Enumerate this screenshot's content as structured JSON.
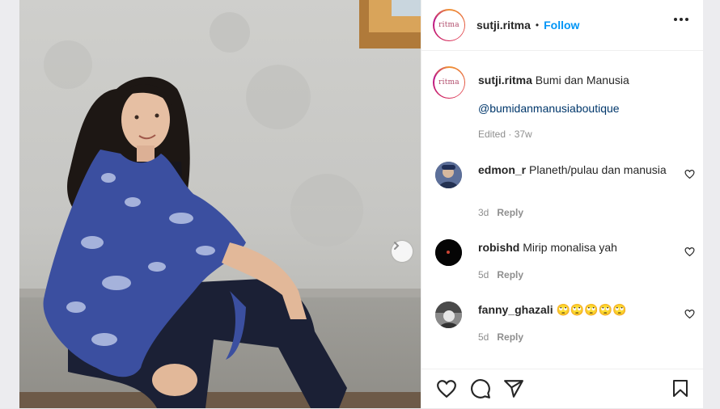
{
  "post": {
    "username": "sutji.ritma",
    "follow_label": "Follow",
    "separator": "•",
    "avatar_text": "ritma"
  },
  "caption": {
    "username": "sutji.ritma",
    "text": "Bumi dan Manusia",
    "mention": "@bumidanmanusiaboutique",
    "meta": "Edited · 37w"
  },
  "comments": [
    {
      "user": "edmon_r",
      "text": "Planeth/pulau dan manusia",
      "time": "3d",
      "reply": "Reply"
    },
    {
      "user": "robishd",
      "text": "Mirip monalisa yah",
      "time": "5d",
      "reply": "Reply"
    },
    {
      "user": "fanny_ghazali",
      "text": "🙄🙄🙄🙄🙄",
      "time": "5d",
      "reply": "Reply"
    }
  ],
  "icons": {
    "more": "more-horizontal-icon",
    "next": "chevron-right-icon",
    "like": "heart-icon",
    "comment": "comment-icon",
    "share": "send-icon",
    "save": "bookmark-icon"
  },
  "colors": {
    "follow": "#0095f6",
    "mention": "#00376b",
    "meta": "#8e8e8e",
    "scarf": "#3b4fa0"
  }
}
